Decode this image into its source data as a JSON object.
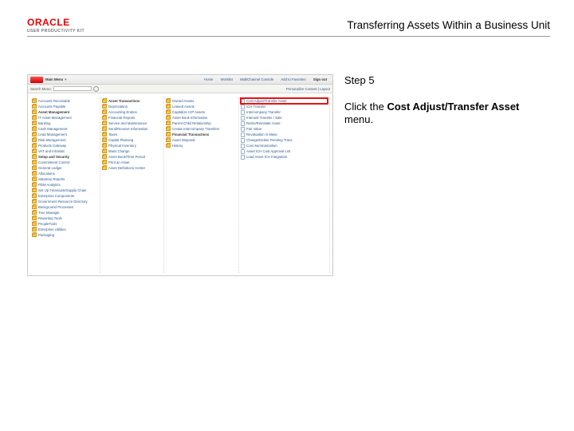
{
  "header": {
    "brand_top": "ORACLE",
    "brand_sub": "USER PRODUCTIVITY KIT",
    "title": "Transferring Assets Within a Business Unit"
  },
  "panel": {
    "step": "Step 5",
    "instr_pre": "Click the ",
    "instr_bold": "Cost Adjust/Transfer Asset",
    "instr_post": " menu."
  },
  "app": {
    "topbar": {
      "main_menu": "Main Menu",
      "nav": [
        "Home",
        "Worklist",
        "MultiChannel Console",
        "Add to Favorites"
      ],
      "signout": "Sign out"
    },
    "searchbar": {
      "label": "Search Menu:",
      "right": "Personalize Content | Layout"
    },
    "col1": [
      {
        "t": "Accounts Receivable",
        "k": "f"
      },
      {
        "t": "Accounts Payable",
        "k": "f"
      },
      {
        "t": "Asset Management",
        "k": "f",
        "sec": true
      },
      {
        "t": "IT Asset Management",
        "k": "f"
      },
      {
        "t": "Banking",
        "k": "f"
      },
      {
        "t": "Cash Management",
        "k": "f"
      },
      {
        "t": "Lead Management",
        "k": "f"
      },
      {
        "t": "Risk Management",
        "k": "f"
      },
      {
        "t": "Products Gateway",
        "k": "f"
      },
      {
        "t": "VAT and Intrastat",
        "k": "f"
      },
      {
        "t": "Setup and Security",
        "k": "f",
        "sec": true
      },
      {
        "t": "Commitment Control",
        "k": "f"
      },
      {
        "t": "General Ledger",
        "k": "f"
      },
      {
        "t": "Allocations",
        "k": "f"
      },
      {
        "t": "Statutory Reports",
        "k": "f"
      },
      {
        "t": "PDM Analytics",
        "k": "f"
      },
      {
        "t": "Set Up Financials/Supply Chain",
        "k": "f"
      },
      {
        "t": "Enterprise Components",
        "k": "f"
      },
      {
        "t": "Government Resource Directory",
        "k": "f"
      },
      {
        "t": "Background Processes",
        "k": "f"
      },
      {
        "t": "Tree Manager",
        "k": "f"
      },
      {
        "t": "Reporting Tools",
        "k": "f"
      },
      {
        "t": "PeopleTools",
        "k": "f"
      },
      {
        "t": "Enterprise Utilities",
        "k": "f"
      },
      {
        "t": "Packaging",
        "k": "f"
      }
    ],
    "col2": [
      {
        "t": "Asset Transactions",
        "k": "f",
        "sec": true
      },
      {
        "t": "Depreciation",
        "k": "f"
      },
      {
        "t": "Accounting Entries",
        "k": "f"
      },
      {
        "t": "Financial Reports",
        "k": "f"
      },
      {
        "t": "Service and Maintenance",
        "k": "f"
      },
      {
        "t": "Send/Receive Information",
        "k": "f"
      },
      {
        "t": "Taxes",
        "k": "f"
      },
      {
        "t": "Capital Planning",
        "k": "f"
      },
      {
        "t": "Physical Inventory",
        "k": "f"
      },
      {
        "t": "Mass Change",
        "k": "f"
      },
      {
        "t": "Asset Book/Time Period",
        "k": "f"
      },
      {
        "t": "Print an Asset",
        "k": "f"
      },
      {
        "t": "Asset Definitions Center",
        "k": "f"
      }
    ],
    "col3": [
      {
        "t": "Owned Assets",
        "k": "f"
      },
      {
        "t": "Leased Assets",
        "k": "f"
      },
      {
        "t": "Capitalize CIP Assets",
        "k": "f"
      },
      {
        "t": "Asset Book Information",
        "k": "f"
      },
      {
        "t": "Parent-Child Relationship",
        "k": "f"
      },
      {
        "t": "Create Intercompany Transfers",
        "k": "f"
      },
      {
        "t": "Financial Transactions",
        "k": "f",
        "sec": true
      },
      {
        "t": "Asset Disposal",
        "k": "f"
      },
      {
        "t": "History",
        "k": "f"
      }
    ],
    "col4": [
      {
        "t": "Cost Adjust/Transfer Asset",
        "k": "d",
        "hl": true
      },
      {
        "t": "ICH Transfer",
        "k": "d"
      },
      {
        "t": "Intercompany Transfer",
        "k": "d"
      },
      {
        "t": "Interunit Transfer / Sale",
        "k": "d"
      },
      {
        "t": "Retire/Reinstate Asset",
        "k": "d"
      },
      {
        "t": "Fair Value",
        "k": "d"
      },
      {
        "t": "Revaluation in Mass",
        "k": "d"
      },
      {
        "t": "Change/Delete Pending Trans",
        "k": "d"
      },
      {
        "t": "Cost Summarization",
        "k": "d"
      },
      {
        "t": "Asset ICH Cost Approval List",
        "k": "d"
      },
      {
        "t": "Load Asset ICH Integration",
        "k": "d"
      }
    ]
  }
}
